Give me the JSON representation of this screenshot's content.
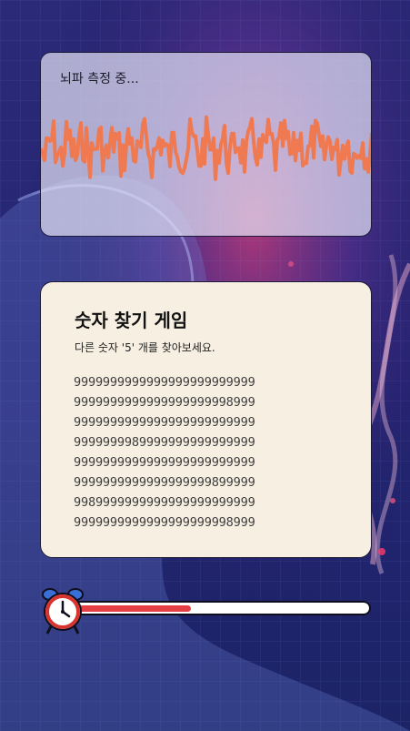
{
  "eeg": {
    "title": "뇌파 측정 중...",
    "wave_color": "#ef7a52"
  },
  "game": {
    "title": "숫자 찾기 게임",
    "instruction": "다른 숫자 '5' 개를 찾아보세요.",
    "rows": [
      "9999999999999999999999999",
      "9999999999999999999998999",
      "9999999999999999999999999",
      "9999999989999999999999999",
      "9999999999999999999999999",
      "9999999999999999999899999",
      "9989999999999999999999999",
      "9999999999999999999998999"
    ]
  },
  "timer": {
    "icon": "alarm-clock-icon",
    "progress": 0.4,
    "bar_color": "#e43f45"
  }
}
